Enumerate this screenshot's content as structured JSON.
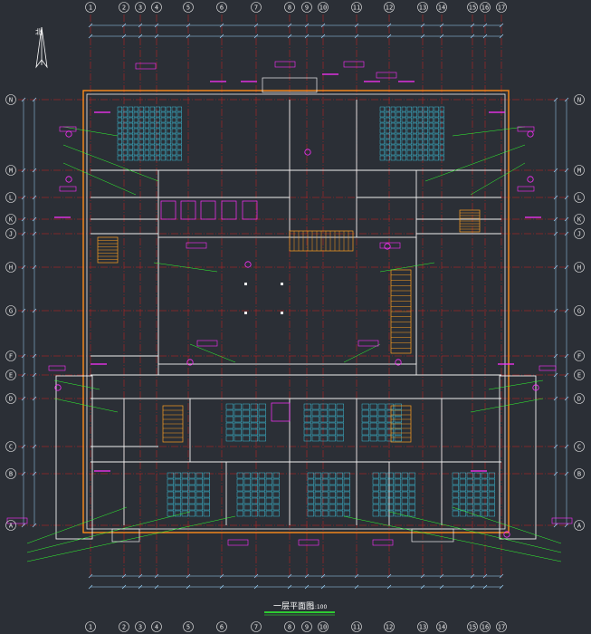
{
  "drawing": {
    "title": "一层平面图",
    "scale": "1:100",
    "north_label": "北"
  },
  "axes": {
    "columns": [
      "1",
      "2",
      "3",
      "4",
      "5",
      "6",
      "7",
      "8",
      "9",
      "10",
      "11",
      "12",
      "13",
      "14",
      "15",
      "16",
      "17"
    ],
    "rows": [
      "A",
      "B",
      "C",
      "D",
      "E",
      "F",
      "G",
      "H",
      "J",
      "K",
      "L",
      "M",
      "N"
    ]
  },
  "colors": {
    "background": "#2b2f36",
    "axis_line": "#d02020",
    "wall": "#f0f0f0",
    "outline": "#ff8c1a",
    "furniture": "#40e0ff",
    "annotation": "#30ff30",
    "tag": "#ff30ff",
    "stair": "#ffa020",
    "dimension": "#9fd8ff"
  }
}
